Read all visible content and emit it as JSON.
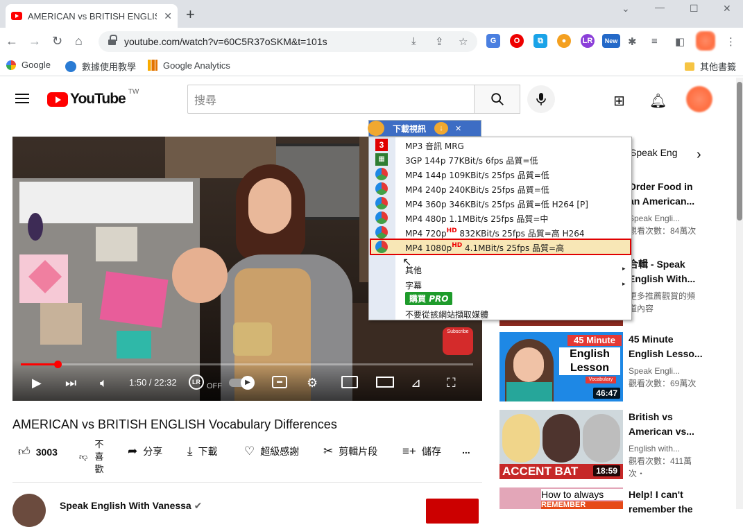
{
  "browser": {
    "tab_title": "AMERICAN vs BRITISH ENGLISH",
    "tab_close": "✕",
    "new_tab": "+",
    "url": "youtube.com/watch?v=60C5R37oSKM&t=101s",
    "bookmarks": [
      {
        "label": "Google"
      },
      {
        "label": "數據使用教學"
      },
      {
        "label": "Google Analytics"
      }
    ],
    "other_bookmarks": "其他書籤",
    "ext_new_badge": "New"
  },
  "youtube": {
    "logo_text": "YouTube",
    "country_code": "TW",
    "search_placeholder": "搜尋",
    "video": {
      "title": "AMERICAN vs BRITISH ENGLISH Vocabulary Differences",
      "time": "1:50 / 22:32",
      "autoplay_label": "OFF",
      "subscribe_overlay": "Subscribe",
      "progress_fraction": 0.082
    },
    "actions": {
      "likes": "3003",
      "dislike": "不喜歡",
      "share": "分享",
      "download": "下載",
      "thanks": "超級感謝",
      "clip": "剪輯片段",
      "save": "儲存",
      "more": "..."
    },
    "channel_name": "Speak English With Vanessa"
  },
  "sidebar": {
    "chip": "Speak Eng",
    "videos": [
      {
        "title1": "Order Food in",
        "title2": "an American...",
        "meta1": "Speak Engli...",
        "meta2": "觀看次數：84萬次"
      },
      {
        "title1": "合輯 - Speak",
        "title2": "English With...",
        "meta1": "更多推薦觀賞的頻",
        "meta2": "道內容"
      },
      {
        "title1": "45 Minute",
        "title2": "English Lesso...",
        "meta1": "Speak Engli...",
        "meta2": "觀看次數：69萬次",
        "thumb_line1": "45 Minute",
        "thumb_line2": "English",
        "thumb_line3": "Lesson",
        "thumb_tag": "Vocabulary",
        "duration": "46:47"
      },
      {
        "title1": "British vs",
        "title2": "American vs...",
        "meta1": "English with...",
        "meta2": "觀看次數：411萬",
        "meta3": "次・",
        "thumb_caption": "ACCENT BAT",
        "duration": "18:59"
      },
      {
        "title1": "Help! I can't",
        "title2": "remember the",
        "thumb_line1": "How to always",
        "thumb_line2": "REMEMBER"
      }
    ]
  },
  "downloader": {
    "header": "下載視訊",
    "items": [
      {
        "label": "MP3 音訊 MRG",
        "icon": "mp3-icon"
      },
      {
        "label": "3GP 144p 77KBit/s 6fps 品質=低",
        "icon": "3gp-icon"
      },
      {
        "label": "MP4 144p 109KBit/s 25fps 品質=低",
        "icon": "mp4-icon"
      },
      {
        "label": "MP4 240p 240KBit/s 25fps 品質=低",
        "icon": "mp4-icon"
      },
      {
        "label": "MP4 360p 346KBit/s 25fps 品質=低 H264 [P]",
        "icon": "mp4-icon"
      },
      {
        "label": "MP4 480p 1.1MBit/s 25fps 品質=中",
        "icon": "mp4-icon"
      },
      {
        "label_a": "MP4 720p",
        "hd": "HD",
        "label_b": " 832KBit/s 25fps 品質=高 H264",
        "icon": "mp4-icon"
      },
      {
        "label_a": "MP4 1080p",
        "hd": "HD",
        "label_b": " 4.1MBit/s 25fps 品質=高",
        "icon": "mp4-icon",
        "selected": true
      }
    ],
    "other": "其他",
    "subtitles": "字幕",
    "buy_label": "購買",
    "buy_pro": "PRO",
    "exclude": "不要從該網站擷取媒體"
  },
  "colors": {
    "yt_red": "#ff0000",
    "selection_border": "#e00000",
    "selection_fill": "#f8e7b6",
    "dl_header": "#3d6dc4",
    "buy_green": "#1e9b2b"
  }
}
